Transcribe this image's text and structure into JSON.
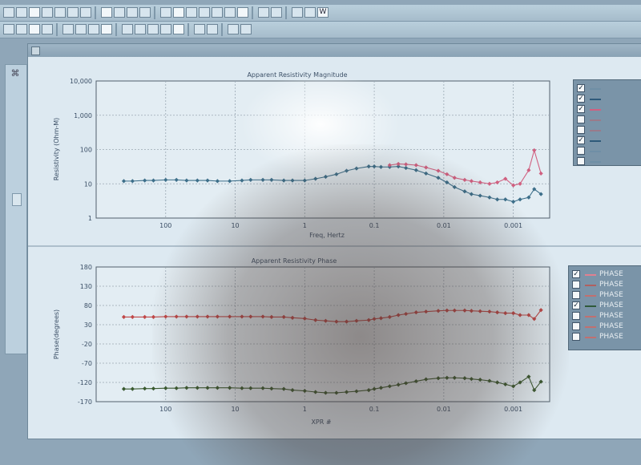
{
  "toolbar": {
    "row1": [
      "",
      "",
      "",
      "",
      "",
      "",
      "",
      "",
      "",
      "",
      "",
      "",
      "",
      "",
      "",
      "",
      "",
      "",
      "",
      "",
      "",
      "",
      "W"
    ],
    "row2": [
      "",
      "",
      "",
      "",
      "",
      "",
      "",
      "",
      "",
      "",
      "",
      "",
      "",
      "",
      "",
      "",
      ""
    ]
  },
  "window": {
    "title": ""
  },
  "legend_top": [
    {
      "checked": true,
      "color": "#6f8fa6",
      "label": ""
    },
    {
      "checked": true,
      "color": "#2f5a7a",
      "label": ""
    },
    {
      "checked": true,
      "color": "#d06080",
      "label": ""
    },
    {
      "checked": false,
      "color": "#9a7a8a",
      "label": ""
    },
    {
      "checked": false,
      "color": "#9a7a8a",
      "label": ""
    },
    {
      "checked": true,
      "color": "#2f5a7a",
      "label": ""
    },
    {
      "checked": false,
      "color": "#6f8fa6",
      "label": ""
    },
    {
      "checked": false,
      "color": "#6f8fa6",
      "label": ""
    }
  ],
  "legend_bottom": [
    {
      "checked": true,
      "color": "#e08090",
      "label": "PHASE"
    },
    {
      "checked": false,
      "color": "#b06060",
      "label": "PHASE"
    },
    {
      "checked": false,
      "color": "#c07070",
      "label": "PHASE"
    },
    {
      "checked": true,
      "color": "#2f5a3a",
      "label": "PHASE"
    },
    {
      "checked": false,
      "color": "#c07070",
      "label": "PHASE"
    },
    {
      "checked": false,
      "color": "#c07070",
      "label": "PHASE"
    },
    {
      "checked": false,
      "color": "#c07070",
      "label": "PHASE"
    }
  ],
  "chart_data": [
    {
      "type": "scatter",
      "title": "Apparent Resistivity Magnitude",
      "xlabel": "Freq, Hertz",
      "ylabel": "Resistivity (Ohm-M)",
      "x_scale": "log",
      "x_reversed": true,
      "y_scale": "log",
      "xlim": [
        1000,
        0.0003
      ],
      "ylim": [
        1,
        10000
      ],
      "xticks": [
        100,
        10,
        1,
        0.1,
        0.01,
        0.001
      ],
      "xtick_labels": [
        "100",
        "10",
        "1",
        "0.1",
        "0.01",
        "0.001"
      ],
      "yticks": [
        1,
        10,
        100,
        1000,
        10000
      ],
      "ytick_labels": [
        "1",
        "10",
        "100",
        "1,000",
        "10,000"
      ],
      "grid": true,
      "series": [
        {
          "color": "#3d6f8a",
          "x": [
            400,
            300,
            200,
            150,
            100,
            70,
            50,
            35,
            25,
            18,
            12,
            8,
            6,
            4,
            3,
            2,
            1.5,
            1,
            0.7,
            0.5,
            0.35,
            0.25,
            0.18,
            0.12,
            0.1,
            0.08,
            0.06,
            0.045,
            0.035,
            0.025,
            0.018,
            0.012,
            0.009,
            0.007,
            0.005,
            0.004,
            0.003,
            0.0022,
            0.0017,
            0.0013,
            0.001,
            0.0008,
            0.0006,
            0.0005,
            0.0004
          ],
          "y": [
            12,
            12,
            12.5,
            12.5,
            13,
            13,
            12.5,
            12.5,
            12.5,
            12,
            12,
            12.5,
            13,
            13,
            13,
            12.5,
            12.5,
            12.5,
            14,
            16,
            19,
            24,
            28,
            32,
            32,
            31,
            31,
            32,
            29,
            25,
            20,
            15,
            11,
            8,
            6,
            5,
            4.5,
            4,
            3.5,
            3.5,
            3,
            3.5,
            4,
            7,
            5
          ]
        },
        {
          "color": "#d06080",
          "x": [
            0.06,
            0.045,
            0.035,
            0.025,
            0.018,
            0.012,
            0.009,
            0.007,
            0.005,
            0.004,
            0.003,
            0.0022,
            0.0017,
            0.0013,
            0.001,
            0.0008,
            0.0006,
            0.0005,
            0.0004
          ],
          "y": [
            35,
            38,
            37,
            35,
            30,
            24,
            19,
            15,
            13,
            12,
            11,
            10,
            11,
            14,
            9,
            10,
            25,
            95,
            20
          ]
        }
      ]
    },
    {
      "type": "scatter",
      "title": "Apparent Resistivity Phase",
      "xlabel": "XPR #",
      "ylabel": "Phase(degrees)",
      "x_scale": "log",
      "x_reversed": true,
      "xlim": [
        1000,
        0.0003
      ],
      "ylim": [
        -170,
        180
      ],
      "xticks": [
        100,
        10,
        1,
        0.1,
        0.01,
        0.001
      ],
      "xtick_labels": [
        "100",
        "10",
        "1",
        "0.1",
        "0.01",
        "0.001"
      ],
      "yticks": [
        180,
        130,
        80,
        30,
        -20,
        -70,
        -120,
        -170
      ],
      "ytick_labels": [
        "180",
        "130",
        "80",
        "30",
        "-20",
        "-70",
        "-120",
        "-170"
      ],
      "grid": true,
      "series": [
        {
          "color": "#c04848",
          "x": [
            400,
            300,
            200,
            150,
            100,
            70,
            50,
            35,
            25,
            18,
            12,
            8,
            6,
            4,
            3,
            2,
            1.5,
            1,
            0.7,
            0.5,
            0.35,
            0.25,
            0.18,
            0.12,
            0.1,
            0.08,
            0.06,
            0.045,
            0.035,
            0.025,
            0.018,
            0.012,
            0.009,
            0.007,
            0.005,
            0.004,
            0.003,
            0.0022,
            0.0017,
            0.0013,
            0.001,
            0.0008,
            0.0006,
            0.0005,
            0.0004
          ],
          "y": [
            50,
            50,
            50,
            50,
            51,
            51,
            51,
            51,
            51,
            51,
            51,
            51,
            51,
            51,
            50,
            50,
            48,
            46,
            42,
            40,
            38,
            38,
            40,
            42,
            45,
            47,
            50,
            55,
            58,
            62,
            64,
            66,
            67,
            67,
            67,
            66,
            65,
            64,
            62,
            60,
            60,
            55,
            55,
            45,
            68
          ]
        },
        {
          "color": "#3a5a30",
          "x": [
            400,
            300,
            200,
            150,
            100,
            70,
            50,
            35,
            25,
            18,
            12,
            8,
            6,
            4,
            3,
            2,
            1.5,
            1,
            0.7,
            0.5,
            0.35,
            0.25,
            0.18,
            0.12,
            0.1,
            0.08,
            0.06,
            0.045,
            0.035,
            0.025,
            0.018,
            0.012,
            0.009,
            0.007,
            0.005,
            0.004,
            0.003,
            0.0022,
            0.0017,
            0.0013,
            0.001,
            0.0008,
            0.0006,
            0.0005,
            0.0004
          ],
          "y": [
            -137,
            -137,
            -136,
            -136,
            -135,
            -135,
            -134,
            -134,
            -134,
            -134,
            -134,
            -135,
            -135,
            -135,
            -136,
            -137,
            -140,
            -142,
            -145,
            -147,
            -147,
            -145,
            -143,
            -140,
            -137,
            -134,
            -130,
            -126,
            -122,
            -117,
            -112,
            -109,
            -108,
            -108,
            -109,
            -111,
            -113,
            -116,
            -120,
            -125,
            -130,
            -120,
            -105,
            -140,
            -118
          ]
        }
      ]
    }
  ]
}
